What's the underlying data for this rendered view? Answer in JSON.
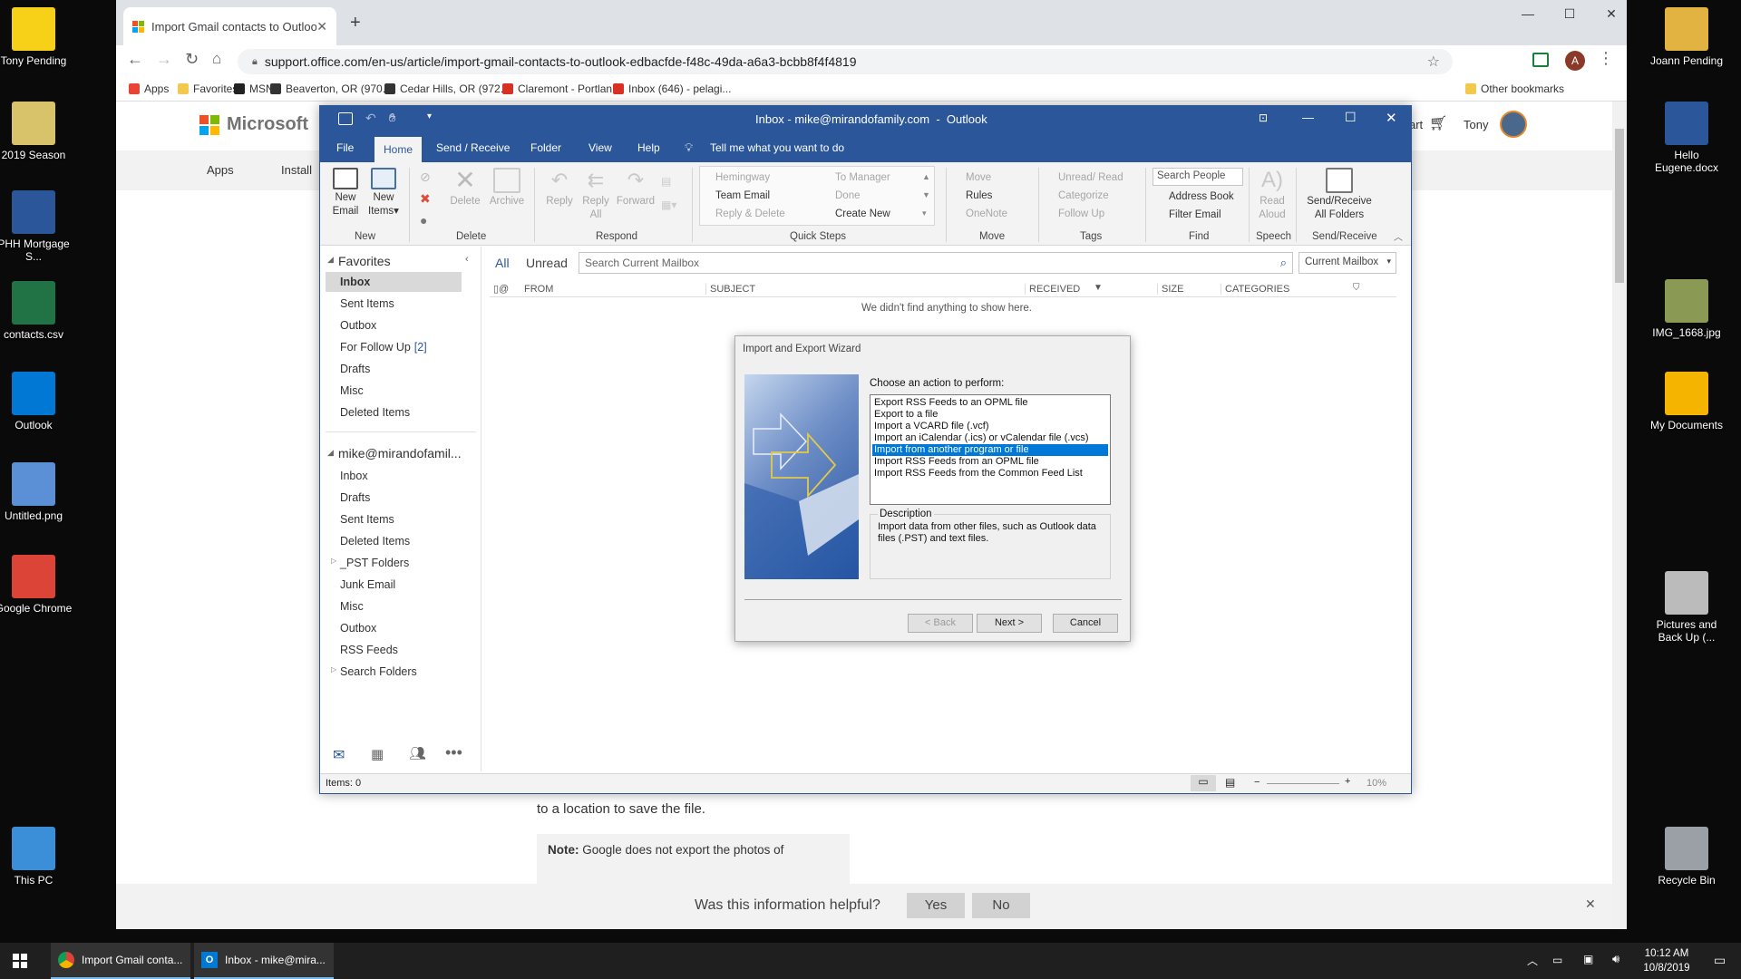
{
  "desktop_left": [
    {
      "label": "Tony Pending",
      "icon": "warning-icon",
      "color": "#f7d117"
    },
    {
      "label": "2019 Season",
      "icon": "zip-folder-icon",
      "color": "#d9c36a"
    },
    {
      "label": "PHH Mortgage S...",
      "icon": "word-icon",
      "color": "#2b579a"
    },
    {
      "label": "contacts.csv",
      "icon": "excel-icon",
      "color": "#217346"
    },
    {
      "label": "Outlook",
      "icon": "outlook-icon",
      "color": "#0078d4"
    },
    {
      "label": "Untitled.png",
      "icon": "image-file-icon",
      "color": "#5b8fd6"
    },
    {
      "label": "Google Chrome",
      "icon": "chrome-icon",
      "color": "#db4437"
    },
    {
      "label": "This PC",
      "icon": "computer-icon",
      "color": "#3a8fd8"
    }
  ],
  "desktop_right": [
    {
      "label": "Joann Pending",
      "icon": "lock-icon",
      "color": "#e3b341"
    },
    {
      "label": "Hello Eugene.docx",
      "icon": "word-icon",
      "color": "#2b579a"
    },
    {
      "label": "IMG_1668.jpg",
      "icon": "photo-icon",
      "color": "#8a9a55"
    },
    {
      "label": "My Documents",
      "icon": "star-icon",
      "color": "#f5b400"
    },
    {
      "label": "Pictures and Back Up (...",
      "icon": "drive-icon",
      "color": "#bbbbbb"
    },
    {
      "label": "Recycle Bin",
      "icon": "recycle-bin-icon",
      "color": "#9aa0a6"
    }
  ],
  "browser": {
    "tab_title": "Import Gmail contacts to Outloo",
    "url": "support.office.com/en-us/article/import-gmail-contacts-to-outlook-edbacfde-f48c-49da-a6a3-bcbb8f4f4819",
    "profile_initial": "A",
    "bookmarks": [
      "Apps",
      "Favorites",
      "MSN",
      "Beaverton, OR (970...",
      "Cedar Hills, OR (972...",
      "Claremont - Portlan...",
      "Inbox (646) - pelagi...",
      "Other bookmarks"
    ]
  },
  "ms_page": {
    "brand": "Microsoft",
    "nav": [
      "Apps",
      "Install"
    ],
    "cart": "art",
    "user": "Tony",
    "body_text": "to a location to save the file.",
    "note_label": "Note:",
    "note_text": "Google does not export the photos of",
    "feedback_q": "Was this information helpful?",
    "yes": "Yes",
    "no": "No"
  },
  "outlook": {
    "title": "Inbox - mike@mirandofamily.com  -  Outlook",
    "tabs": [
      "File",
      "Home",
      "Send / Receive",
      "Folder",
      "View",
      "Help"
    ],
    "tell_me": "Tell me what you want to do",
    "ribbon": {
      "new_email": "New Email",
      "new_items": "New Items",
      "delete": "Delete",
      "archive": "Archive",
      "reply": "Reply",
      "reply_all": "Reply All",
      "forward": "Forward",
      "quick_steps": [
        "Hemingway",
        "Team Email",
        "Reply & Delete",
        "To Manager",
        "Done",
        "Create New"
      ],
      "move": "Move",
      "rules": "Rules",
      "onenote": "OneNote",
      "unread_read": "Unread/ Read",
      "categorize": "Categorize",
      "follow_up": "Follow Up",
      "search_people": "Search People",
      "address_book": "Address Book",
      "filter_email": "Filter Email",
      "read_aloud": "Read Aloud",
      "send_receive_all": "Send/Receive All Folders",
      "groups": [
        "New",
        "Delete",
        "Respond",
        "Quick Steps",
        "Move",
        "Tags",
        "Find",
        "Speech",
        "Send/Receive"
      ]
    },
    "favorites_header": "Favorites",
    "favorites": [
      "Inbox",
      "Sent Items",
      "Outbox",
      "For Follow Up",
      "Drafts",
      "Misc",
      "Deleted Items"
    ],
    "follow_up_count": "[2]",
    "account": "mike@mirandofamil...",
    "account_folders": [
      "Inbox",
      "Drafts",
      "Sent Items",
      "Deleted Items",
      "_PST Folders",
      "Junk Email",
      "Misc",
      "Outbox",
      "RSS Feeds",
      "Search Folders"
    ],
    "filter_all": "All",
    "filter_unread": "Unread",
    "search_placeholder": "Search Current Mailbox",
    "scope": "Current Mailbox",
    "columns": [
      "FROM",
      "SUBJECT",
      "RECEIVED",
      "SIZE",
      "CATEGORIES"
    ],
    "empty": "We didn't find anything to show here.",
    "status_items": "Items: 0",
    "zoom": "10%"
  },
  "wizard": {
    "title": "Import and Export Wizard",
    "prompt": "Choose an action to perform:",
    "options": [
      "Export RSS Feeds to an OPML file",
      "Export to a file",
      "Import a VCARD file (.vcf)",
      "Import an iCalendar (.ics) or vCalendar file (.vcs)",
      "Import from another program or file",
      "Import RSS Feeds from an OPML file",
      "Import RSS Feeds from the Common Feed List"
    ],
    "selected_index": 4,
    "desc_label": "Description",
    "desc_text": "Import data from other files, such as Outlook data files (.PST) and text files.",
    "back": "< Back",
    "next": "Next >",
    "cancel": "Cancel"
  },
  "taskbar": {
    "items": [
      "Import Gmail conta...",
      "Inbox - mike@mira..."
    ],
    "time": "10:12 AM",
    "date": "10/8/2019"
  }
}
